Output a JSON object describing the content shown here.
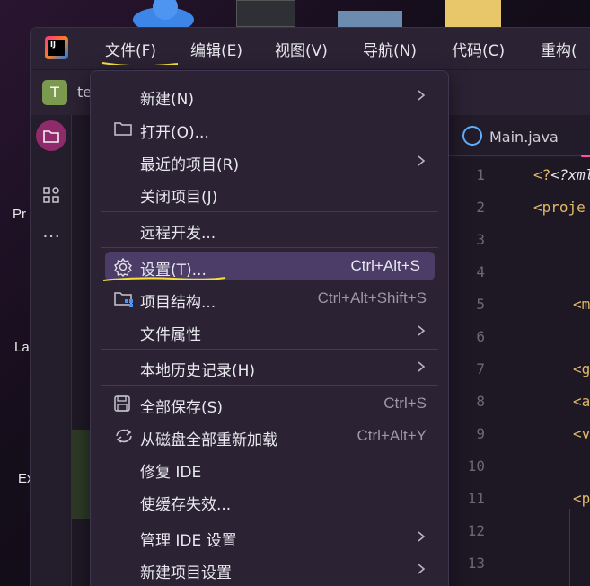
{
  "desktop": {
    "labels": [
      "Pr",
      "La",
      "Ex"
    ]
  },
  "menubar": {
    "items": [
      {
        "label": "文件(F)"
      },
      {
        "label": "编辑(E)"
      },
      {
        "label": "视图(V)"
      },
      {
        "label": "导航(N)"
      },
      {
        "label": "代码(C)"
      },
      {
        "label": "重构("
      }
    ]
  },
  "project": {
    "avatar_letter": "T",
    "name": "te"
  },
  "editor": {
    "tab_label": "Main.java",
    "line_numbers": [
      "1",
      "2",
      "3",
      "4",
      "5",
      "6",
      "7",
      "8",
      "9",
      "10",
      "11",
      "12",
      "13"
    ],
    "code_lines": [
      "<?xml",
      "<proje",
      "<m",
      "<g",
      "<a",
      "<v",
      "<p"
    ]
  },
  "dropdown": {
    "items": [
      {
        "label": "新建(N)",
        "shortcut": "",
        "submenu": true,
        "icon": ""
      },
      {
        "label": "打开(O)...",
        "shortcut": "",
        "submenu": false,
        "icon": "folder-icon"
      },
      {
        "label": "最近的项目(R)",
        "shortcut": "",
        "submenu": true,
        "icon": ""
      },
      {
        "label": "关闭项目(J)",
        "shortcut": "",
        "submenu": false,
        "icon": ""
      },
      {
        "label": "远程开发...",
        "shortcut": "",
        "submenu": false,
        "icon": ""
      },
      {
        "label": "设置(T)...",
        "shortcut": "Ctrl+Alt+S",
        "submenu": false,
        "icon": "gear-icon",
        "selected": true
      },
      {
        "label": "项目结构...",
        "shortcut": "Ctrl+Alt+Shift+S",
        "submenu": false,
        "icon": "project-structure-icon"
      },
      {
        "label": "文件属性",
        "shortcut": "",
        "submenu": true,
        "icon": ""
      },
      {
        "label": "本地历史记录(H)",
        "shortcut": "",
        "submenu": true,
        "icon": ""
      },
      {
        "label": "全部保存(S)",
        "shortcut": "Ctrl+S",
        "submenu": false,
        "icon": "save-icon"
      },
      {
        "label": "从磁盘全部重新加载",
        "shortcut": "Ctrl+Alt+Y",
        "submenu": false,
        "icon": "reload-icon"
      },
      {
        "label": "修复 IDE",
        "shortcut": "",
        "submenu": false,
        "icon": ""
      },
      {
        "label": "使缓存失效...",
        "shortcut": "",
        "submenu": false,
        "icon": ""
      },
      {
        "label": "管理 IDE 设置",
        "shortcut": "",
        "submenu": true,
        "icon": ""
      },
      {
        "label": "新建项目设置",
        "shortcut": "",
        "submenu": true,
        "icon": ""
      }
    ]
  },
  "colors": {
    "accent": "#4b3d68",
    "annotation": "#f5e03a",
    "menu_bg": "#2b2234"
  }
}
